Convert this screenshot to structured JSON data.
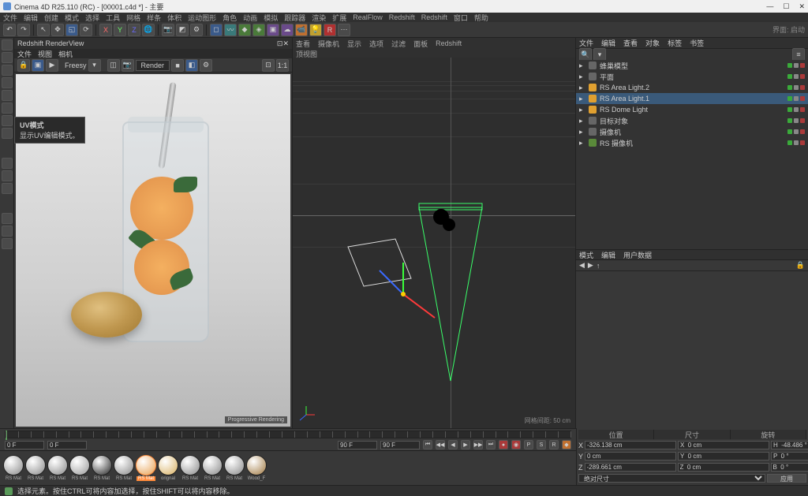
{
  "title": "Cinema 4D R25.110 (RC) - [00001.c4d *] - 主要",
  "menu": [
    "文件",
    "编辑",
    "创建",
    "模式",
    "选择",
    "工具",
    "网格",
    "样条",
    "体积",
    "运动图形",
    "角色",
    "动画",
    "模拟",
    "跟踪器",
    "渲染",
    "扩展",
    "RealFlow",
    "Redshift",
    "Redshift",
    "窗口",
    "帮助"
  ],
  "renderview": {
    "title": "Redshift RenderView",
    "tabs": [
      "文件",
      "视图",
      "相机"
    ],
    "axis_label": "Freesy",
    "render_dropdown": "Render",
    "status": "Progressive Rendering"
  },
  "tooltip_title": "UV模式",
  "tooltip_text": "显示UV编辑模式。",
  "viewport": {
    "tabs": [
      "查看",
      "摄像机",
      "显示",
      "选项",
      "过滤",
      "面板",
      "Redshift"
    ],
    "panel_label": "顶视图",
    "footer": "网格间距: 50 cm"
  },
  "objpanel": {
    "tabs": [
      "文件",
      "编辑",
      "查看",
      "对象",
      "标签",
      "书签"
    ],
    "items": [
      {
        "name": "蜂巢模型",
        "sel": false,
        "icon": "obj"
      },
      {
        "name": "平面",
        "sel": false,
        "icon": "obj"
      },
      {
        "name": "RS Area Light.2",
        "sel": false,
        "icon": "light"
      },
      {
        "name": "RS Area Light.1",
        "sel": true,
        "icon": "light"
      },
      {
        "name": "RS Dome Light",
        "sel": false,
        "icon": "light"
      },
      {
        "name": "目标对象",
        "sel": false,
        "icon": "obj"
      },
      {
        "name": "摄像机",
        "sel": false,
        "icon": "obj"
      },
      {
        "name": "RS 摄像机",
        "sel": false,
        "icon": "cam"
      }
    ]
  },
  "attr": {
    "tabs": [
      "模式",
      "编辑",
      "用户数据"
    ]
  },
  "timeline": {
    "start": "0 F",
    "cur": "0 F",
    "end": "90 F",
    "end2": "90 F"
  },
  "coords": {
    "headers": [
      "位置",
      "尺寸",
      "旋转"
    ],
    "rows": [
      {
        "label": "X",
        "pos": "-326.138 cm",
        "size": "X  0 cm",
        "rot": "H  -48.486 °"
      },
      {
        "label": "Y",
        "pos": "0 cm",
        "size": "Y  0 cm",
        "rot": "P  0 °"
      },
      {
        "label": "Z",
        "pos": "-289.661 cm",
        "size": "Z  0 cm",
        "rot": "B  0 °"
      }
    ],
    "mode_label": "绝对尺寸",
    "apply": "应用"
  },
  "materials": [
    "RS Mat",
    "RS Mat",
    "RS Mat",
    "RS Mat",
    "RS Mat",
    "RS Mat",
    "RS Mat",
    "orignal",
    "RS Mat",
    "RS Mat",
    "RS Mat",
    "Wood_F"
  ],
  "status": "选择元素。按住CTRL可将内容加选择，按住SHIFT可以将内容移除。"
}
